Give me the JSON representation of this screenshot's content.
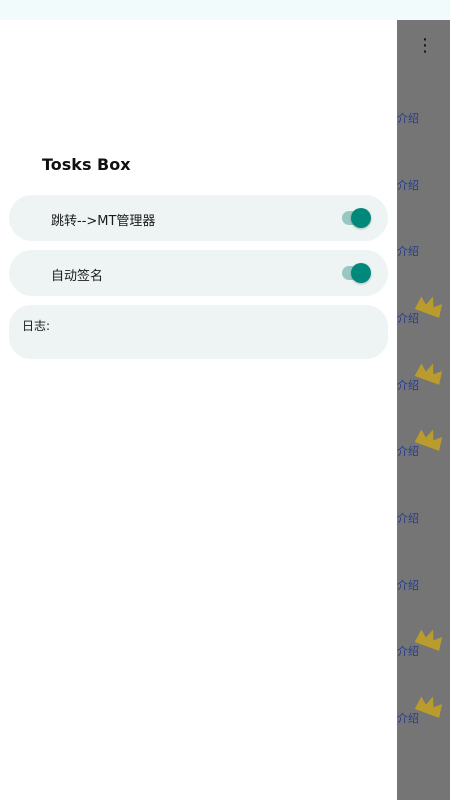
{
  "drawer": {
    "title": "Tosks Box",
    "settings": [
      {
        "label": "跳转-->MT管理器",
        "enabled": true
      },
      {
        "label": "自动签名",
        "enabled": true
      }
    ],
    "log_label": "日志:"
  },
  "background_app": {
    "menu_icon": "more-vert-icon",
    "items": [
      {
        "text": "介绍",
        "badge": false
      },
      {
        "text": "介绍",
        "badge": false
      },
      {
        "text": "介绍",
        "badge": false
      },
      {
        "text": "介绍",
        "badge": true
      },
      {
        "text": "介绍",
        "badge": true
      },
      {
        "text": "介绍",
        "badge": true
      },
      {
        "text": "介绍",
        "badge": false
      },
      {
        "text": "介绍",
        "badge": false
      },
      {
        "text": "介绍",
        "badge": true
      },
      {
        "text": "介绍",
        "badge": true
      }
    ]
  },
  "colors": {
    "accent": "#00897b",
    "row_bg": "#edf4f3",
    "scrim": "#757575",
    "badge": "#d8b21a",
    "link_text": "#253b8c"
  }
}
